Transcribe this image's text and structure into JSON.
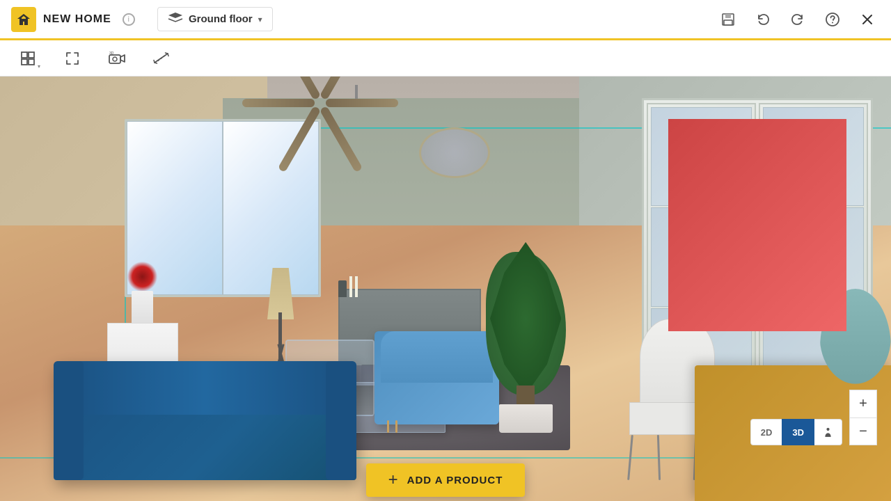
{
  "app": {
    "title": "NEW HOME",
    "info_btn": "i",
    "logo_symbol": "⌂"
  },
  "floor": {
    "label": "Ground floor",
    "icon": "layers"
  },
  "topbar_right": {
    "save_label": "💾",
    "undo_label": "↩",
    "redo_label": "↪",
    "help_label": "?"
  },
  "toolbar": {
    "layout_icon": "⊞",
    "fullscreen_icon": "⛶",
    "camera3d_icon": "📷",
    "measure_icon": "📏"
  },
  "bottom": {
    "add_product_plus": "+",
    "add_product_label": "ADD A PRODUCT"
  },
  "zoom": {
    "plus_label": "+",
    "minus_label": "−"
  },
  "view_toggle": {
    "option_2d": "2D",
    "option_3d": "3D"
  },
  "colors": {
    "accent_yellow": "#f0c325",
    "active_blue": "#1a5898",
    "sofa_blue": "#1a5080",
    "chair_blue": "#5090c0"
  }
}
